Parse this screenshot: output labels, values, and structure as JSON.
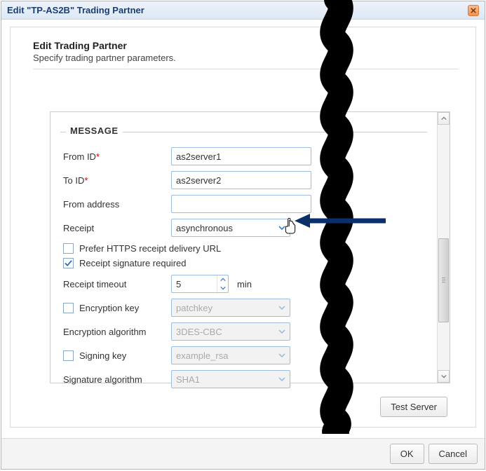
{
  "dialog": {
    "title": "Edit \"TP-AS2B\" Trading Partner"
  },
  "header": {
    "title": "Edit Trading Partner",
    "subtitle": "Specify trading partner parameters."
  },
  "message": {
    "legend": "MESSAGE",
    "from_id_label": "From ID",
    "from_id_value": "as2server1",
    "to_id_label": "To ID",
    "to_id_value": "as2server2",
    "from_address_label": "From address",
    "from_address_value": "",
    "receipt_label": "Receipt",
    "receipt_value": "asynchronous",
    "prefer_https_label": "Prefer HTTPS receipt delivery URL",
    "prefer_https_checked": false,
    "receipt_sig_label": "Receipt signature required",
    "receipt_sig_checked": true,
    "receipt_timeout_label": "Receipt timeout",
    "receipt_timeout_value": "5",
    "receipt_timeout_unit": "min",
    "encryption_key_label": "Encryption key",
    "encryption_key_value": "patchkey",
    "encryption_key_checked": false,
    "encryption_algo_label": "Encryption algorithm",
    "encryption_algo_value": "3DES-CBC",
    "signing_key_label": "Signing key",
    "signing_key_value": "example_rsa",
    "signing_key_checked": false,
    "signature_algo_label": "Signature algorithm",
    "signature_algo_value": "SHA1"
  },
  "buttons": {
    "test_server": "Test Server",
    "ok": "OK",
    "cancel": "Cancel"
  }
}
